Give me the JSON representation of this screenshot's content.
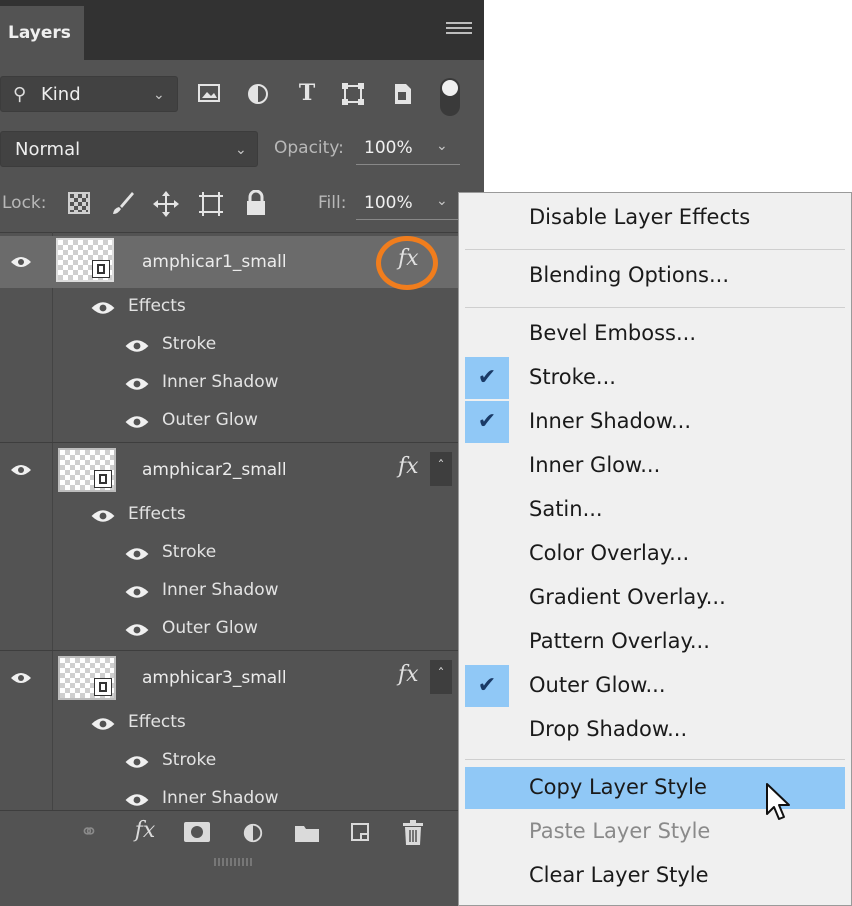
{
  "panel": {
    "tab": "Layers",
    "filter": {
      "label": "Kind",
      "icons": [
        "image-filter-icon",
        "adjustment-filter-icon",
        "type-filter-icon",
        "shape-filter-icon",
        "smart-object-filter-icon",
        "filter-toggle-icon"
      ]
    },
    "blend": {
      "mode": "Normal",
      "opacity_label": "Opacity:",
      "opacity": "100%"
    },
    "lock": {
      "label": "Lock:",
      "fill_label": "Fill:",
      "fill": "100%"
    },
    "layers": [
      {
        "name": "amphicar1_small",
        "fx": "fx",
        "selected": true,
        "effects_label": "Effects",
        "effects": [
          "Stroke",
          "Inner Shadow",
          "Outer Glow"
        ]
      },
      {
        "name": "amphicar2_small",
        "fx": "fx",
        "selected": false,
        "effects_label": "Effects",
        "effects": [
          "Stroke",
          "Inner Shadow",
          "Outer Glow"
        ]
      },
      {
        "name": "amphicar3_small",
        "fx": "fx",
        "selected": false,
        "effects_label": "Effects",
        "effects": [
          "Stroke",
          "Inner Shadow"
        ]
      }
    ],
    "bottom_icons": [
      "link-layers-icon",
      "add-layer-style-icon",
      "add-mask-icon",
      "new-adjustment-layer-icon",
      "new-group-icon",
      "new-layer-icon",
      "delete-layer-icon"
    ],
    "fx_glyph": "fx"
  },
  "menu": {
    "items": [
      {
        "label": "Disable Layer Effects",
        "checked": false
      },
      {
        "label": "Blending Options...",
        "checked": false
      },
      {
        "label": "Bevel  Emboss...",
        "checked": false
      },
      {
        "label": "Stroke...",
        "checked": true
      },
      {
        "label": "Inner Shadow...",
        "checked": true
      },
      {
        "label": "Inner Glow...",
        "checked": false
      },
      {
        "label": "Satin...",
        "checked": false
      },
      {
        "label": "Color Overlay...",
        "checked": false
      },
      {
        "label": "Gradient Overlay...",
        "checked": false
      },
      {
        "label": "Pattern Overlay...",
        "checked": false
      },
      {
        "label": "Outer Glow...",
        "checked": true
      },
      {
        "label": "Drop Shadow...",
        "checked": false
      },
      {
        "label": "Copy Layer Style",
        "highlighted": true
      },
      {
        "label": "Paste Layer Style",
        "disabled": true
      },
      {
        "label": "Clear Layer Style"
      }
    ],
    "check_glyph": "✔"
  },
  "colors": {
    "panel_bg": "#535353",
    "selected_layer": "#6b6b6b",
    "menu_bg": "#f0f0f0",
    "menu_highlight": "#90c8f6",
    "callout_ring": "#f07d1d"
  }
}
